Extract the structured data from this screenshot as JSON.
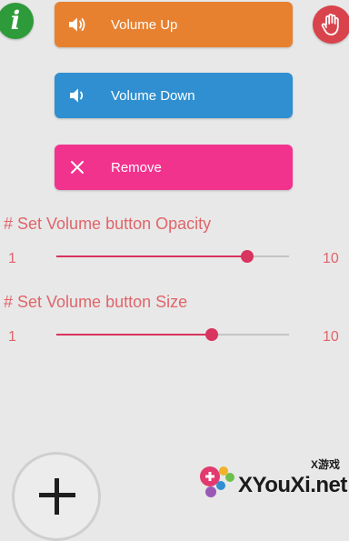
{
  "header": {
    "info_icon_glyph": "i",
    "info_color": "#2e9b3a",
    "stop_color": "#d9434c"
  },
  "buttons": {
    "volume_up": {
      "label": "Volume Up",
      "color": "#e8812f",
      "icon": "speaker-loud-icon"
    },
    "volume_down": {
      "label": "Volume Down",
      "color": "#2f8fd0",
      "icon": "speaker-quiet-icon"
    },
    "remove": {
      "label": "Remove",
      "color": "#f2338e",
      "icon": "close-icon"
    }
  },
  "opacity": {
    "title": "# Set Volume button Opacity",
    "min_label": "1",
    "max_label": "10",
    "min": 1,
    "max": 10,
    "value": 8.4
  },
  "size": {
    "title": "# Set Volume button Size",
    "min_label": "1",
    "max_label": "10",
    "min": 1,
    "max": 10,
    "value": 7.0
  },
  "accent_color": "#d8345f",
  "text_color": "#e0656a",
  "fab": {
    "icon": "plus-icon"
  },
  "watermark": {
    "top_text": "X游戏",
    "main_text": "XYouXi.net"
  }
}
